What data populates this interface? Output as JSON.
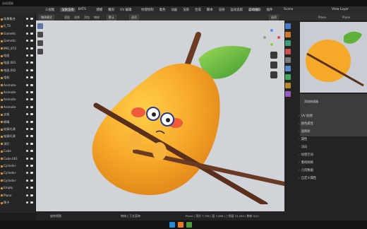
{
  "menubar": {
    "items": [
      "三视图",
      "渲染渲染",
      "BATS",
      "建模",
      "雕刻",
      "UV 编辑",
      "纹理绘制",
      "着色",
      "动画",
      "渲染",
      "合成",
      "脚本",
      "渲染",
      "运动追踪",
      "2D动画",
      "插件"
    ],
    "active_index": 1,
    "scene_label": "Scene",
    "view_layer": "View Layer",
    "extra_label": "自动渲染"
  },
  "viewport": {
    "mode": "物体模式",
    "menu": [
      "视图",
      "选择",
      "添加",
      "物体"
    ],
    "orientation": "默认",
    "pivot": "选项",
    "shading": "选项",
    "status_left": "旋转视图",
    "status_mid": "物体上下文菜单",
    "accent": "#f0a623"
  },
  "outliner": {
    "rows": [
      "场景集合",
      "0_TS",
      "Gametic",
      "Gametic",
      "IMG_872",
      "地面",
      "地面.001",
      "地面.002",
      "相机",
      "Animate",
      "Animate",
      "Animate",
      "Animate",
      "支架",
      "眼睛",
      "轮廓光源",
      "轮廓光源",
      "顶灯",
      "Cube",
      "Cube.001",
      "Cylinder",
      "Cylinder",
      "Cylinder",
      "Empty",
      "Plane",
      "筷子"
    ]
  },
  "properties": {
    "header_left": "Plane",
    "header_right": "Plane",
    "section": "添加修改器",
    "items": [
      "UV 贴图",
      "颜色属性",
      "面映射",
      "属性",
      "法向",
      "纹理空间",
      "重构网格",
      "几何数据",
      "自定义属性"
    ]
  },
  "statusbar": {
    "text": "Plane | 顶点 7,796 | 面 7,698 | 三角面 15,564 | 物体 0/12"
  }
}
